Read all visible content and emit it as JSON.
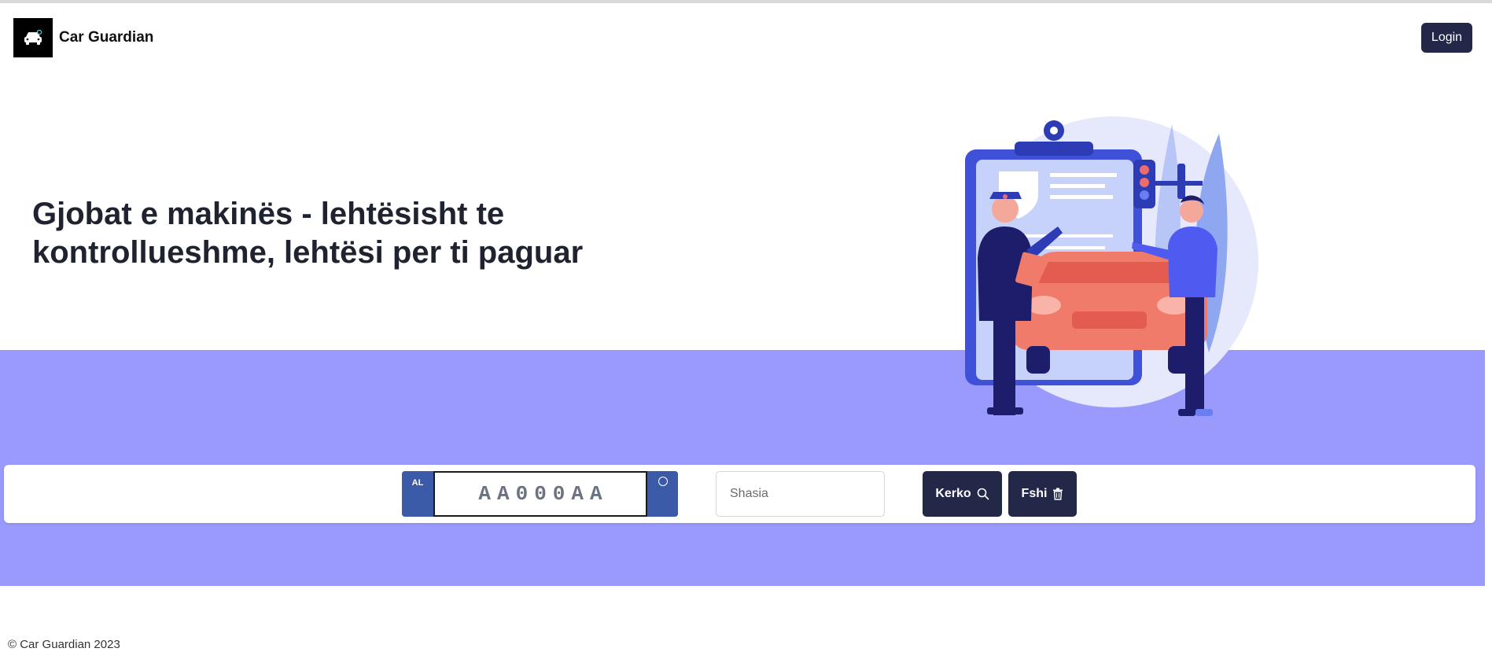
{
  "header": {
    "brand_name": "Car Guardian",
    "logo_icon": "car-shield-icon",
    "login_label": "Login"
  },
  "hero": {
    "title": "Gjobat e makinës - lehtësisht te kontrollueshme, lehtësi per ti paguar",
    "illustration": "traffic-police-car-illustration"
  },
  "search": {
    "plate_country": "AL",
    "plate_placeholder": "AA000AA",
    "chassis_placeholder": "Shasia",
    "search_label": "Kerko",
    "search_icon": "search-icon",
    "clear_label": "Fshi",
    "clear_icon": "trash-icon"
  },
  "footer": {
    "copyright": "© Car Guardian 2023"
  },
  "colors": {
    "primary_button": "#242848",
    "band": "#9a9afd",
    "plate_blue": "#3b5ba8"
  }
}
